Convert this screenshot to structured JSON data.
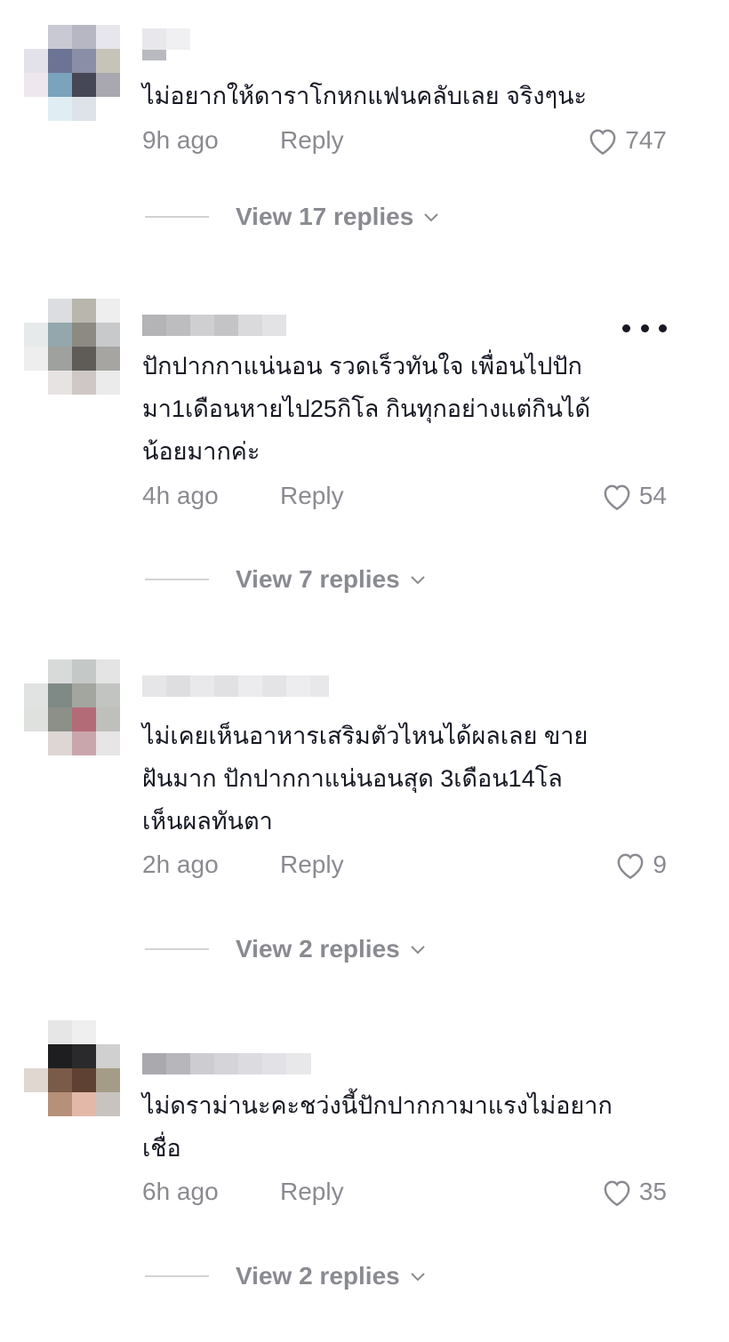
{
  "comments": [
    {
      "text": "ไม่อยากให้ดาราโกหกแฟนคลับเลย จริงๆนะ",
      "time": "9h ago",
      "reply_label": "Reply",
      "likes": "747",
      "view_replies": "View 17 replies"
    },
    {
      "text": "ปักปากกาแน่นอน รวดเร็วทันใจ เพื่อนไปปัก\nมา1เดือนหายไป25กิโล กินทุกอย่างแต่กินได้\nน้อยมากค่ะ",
      "time": "4h ago",
      "reply_label": "Reply",
      "likes": "54",
      "view_replies": "View 7 replies"
    },
    {
      "text": "ไม่เคยเห็นอาหารเสริมตัวไหนได้ผลเลย ขาย\nฝันมาก ปักปากกาแน่นอนสุด 3เดือน14โล\nเห็นผลทันตา",
      "time": "2h ago",
      "reply_label": "Reply",
      "likes": "9",
      "view_replies": "View 2 replies"
    },
    {
      "text": "ไม่ดราม่านะคะชว่งนี้ปักปากกามาแรงไม่อยาก\nเชื่อ",
      "time": "6h ago",
      "reply_label": "Reply",
      "likes": "35",
      "view_replies": "View 2 replies"
    }
  ],
  "icons": {
    "like": "heart-outline-icon",
    "expand": "chevron-down-icon",
    "more": "more-dots-icon"
  },
  "colors": {
    "text": "#161823",
    "secondary": "#8a8b91",
    "divider": "#d3d3d6"
  }
}
